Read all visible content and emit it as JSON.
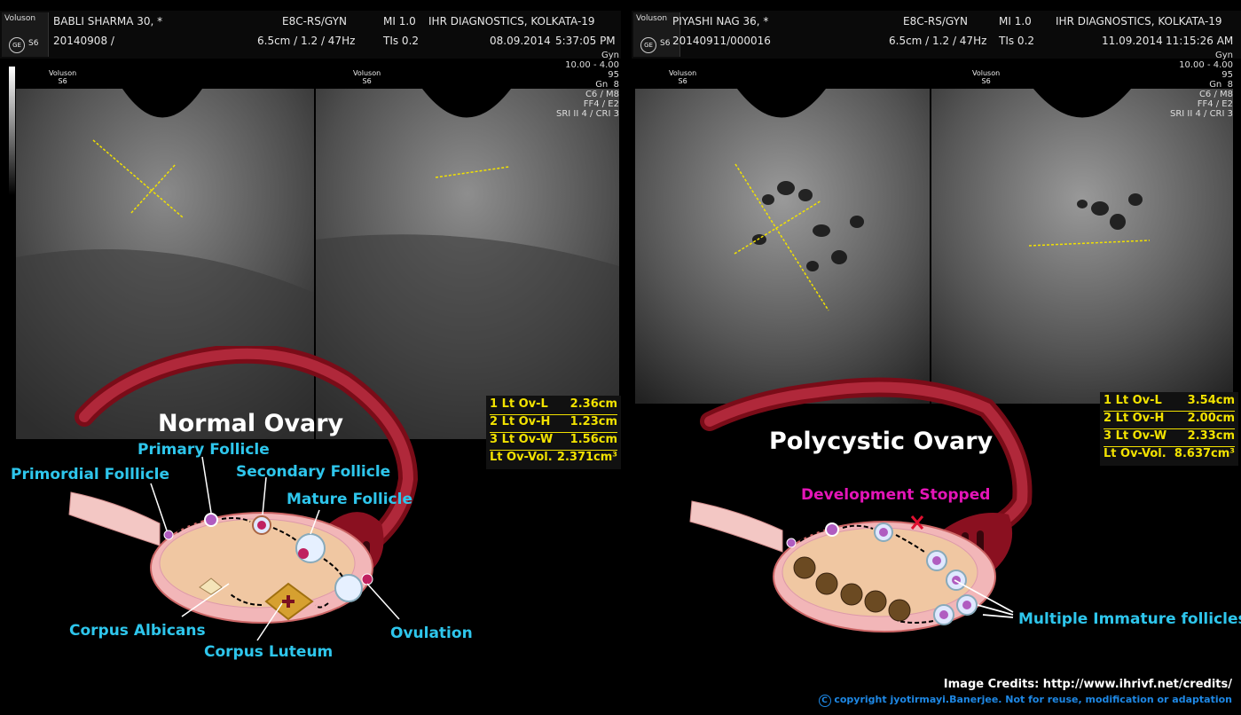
{
  "left_panel": {
    "header": {
      "device": "Voluson",
      "model": "S6",
      "patient": "BABLI SHARMA 30,  *",
      "id": "20140908 /",
      "probe": "E8C-RS/GYN",
      "depth": "6.5cm / 1.2 / 47Hz",
      "mi": "MI  1.0",
      "tis": "TIs  0.2",
      "clinic": "IHR DIAGNOSTICS, KOLKATA-19",
      "date": "08.09.2014",
      "time": "5:37:05 PM"
    },
    "image_labels": [
      "Voluson\nS6",
      "Voluson\nS6"
    ],
    "params": "Gyn\n10.00 - 4.00\n95\nGn  8\nC6 / M8\nFF4 / E2\nSRI II 4 / CRI 3",
    "measurements": [
      {
        "label": "1  Lt Ov-L",
        "value": "2.36cm"
      },
      {
        "label": "2  Lt Ov-H",
        "value": "1.23cm"
      },
      {
        "label": "3  Lt Ov-W",
        "value": "1.56cm"
      },
      {
        "label": "   Lt Ov-Vol.",
        "value": "2.371cm³"
      }
    ],
    "diagram_title": "Normal Ovary",
    "diagram_labels": {
      "primordial": "Primordial Folllicle",
      "primary": "Primary Follicle",
      "secondary": "Secondary Follicle",
      "mature": "Mature Follicle",
      "albicans": "Corpus Albicans",
      "luteum": "Corpus Luteum",
      "ovulation": "Ovulation"
    }
  },
  "right_panel": {
    "header": {
      "device": "Voluson",
      "model": "S6",
      "patient": "PIYASHI NAG 36,  *",
      "id": "20140911/000016",
      "probe": "E8C-RS/GYN",
      "depth": "6.5cm / 1.2 / 47Hz",
      "mi": "MI  1.0",
      "tis": "TIs  0.2",
      "clinic": "IHR DIAGNOSTICS, KOLKATA-19",
      "date": "11.09.2014",
      "time": "11:15:26 AM"
    },
    "image_labels": [
      "Voluson\nS6",
      "Voluson\nS6"
    ],
    "params": "Gyn\n10.00 - 4.00\n95\nGn  8\nC6 / M8\nFF4 / E2\nSRI II 4 / CRI 3",
    "measurements": [
      {
        "label": "1  Lt Ov-L",
        "value": "3.54cm"
      },
      {
        "label": "2  Lt Ov-H",
        "value": "2.00cm"
      },
      {
        "label": "3  Lt Ov-W",
        "value": "2.33cm"
      },
      {
        "label": "   Lt Ov-Vol.",
        "value": "8.637cm³"
      }
    ],
    "diagram_title": "Polycystic Ovary",
    "diagram_labels": {
      "stopped": "Development Stopped",
      "immature": "Multiple Immature follicles"
    }
  },
  "credits": {
    "line1": "Image Credits: http://www.ihrivf.net/credits/",
    "line2": "copyright jyotirmayi.Banerjee. Not for reuse, modification or adaptation"
  },
  "colors": {
    "label_blue": "#2ec6ec",
    "label_magenta": "#e415b7",
    "measure_yellow": "#f2e200",
    "tube_red": "#8a1020",
    "ovary_fill": "#f0c7a2"
  }
}
